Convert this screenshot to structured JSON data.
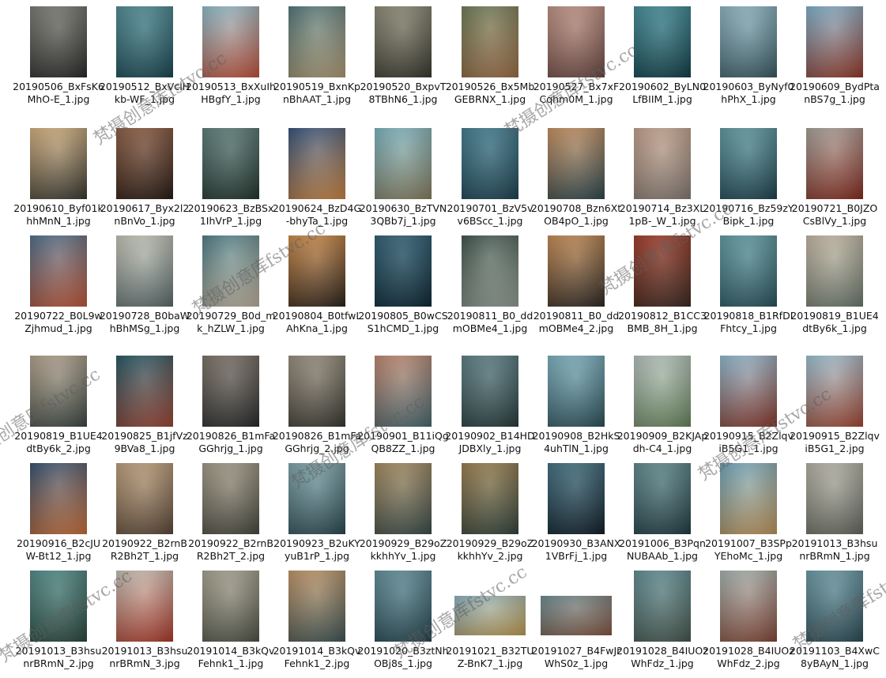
{
  "files": [
    {
      "name": "20190506_BxFsK6MhO-E_1.jpg",
      "c1": "#7a7a72",
      "c2": "#2b2d2a"
    },
    {
      "name": "20190512_BxVclHkb-WF_1.jpg",
      "c1": "#4d8a94",
      "c2": "#1c4a55"
    },
    {
      "name": "20190513_BxXuIhHBgfY_1.jpg",
      "c1": "#8cc0cf",
      "c2": "#c8553c"
    },
    {
      "name": "20190519_BxnKpnBhAAT_1.jpg",
      "c1": "#4e7578",
      "c2": "#b5a079"
    },
    {
      "name": "20190520_BxpvT8TBhN6_1.jpg",
      "c1": "#8d8a74",
      "c2": "#3b3a30"
    },
    {
      "name": "20190526_Bx5MbGEBRNX_1.jpg",
      "c1": "#6c7a56",
      "c2": "#a3724a"
    },
    {
      "name": "20190527_Bx7xFCqhm0M_1.jpg",
      "c1": "#c19383",
      "c2": "#6d4a44"
    },
    {
      "name": "20190602_ByLN0LfBIIM_1.jpg",
      "c1": "#3f8c98",
      "c2": "#14414b"
    },
    {
      "name": "20190603_ByNyf0hPhX_1.jpg",
      "c1": "#8fb7c4",
      "c2": "#3c5d66"
    },
    {
      "name": "20190609_BydPtanBS7g_1.jpg",
      "c1": "#7cb3cf",
      "c2": "#9b3c2a"
    },
    {
      "name": "20190610_Byf01khhMnN_1.jpg",
      "c1": "#d8b37e",
      "c2": "#3a3a34"
    },
    {
      "name": "20190617_Byx2l2nBnVo_1.jpg",
      "c1": "#8d5b3f",
      "c2": "#2a1c16"
    },
    {
      "name": "20190623_BzBSx1IhVrP_1.jpg",
      "c1": "#5b7d79",
      "c2": "#24362f"
    },
    {
      "name": "20190624_BzD4G-bhyTa_1.jpg",
      "c1": "#2d4f7a",
      "c2": "#d38a46"
    },
    {
      "name": "20190630_BzTVN3QBb7j_1.jpg",
      "c1": "#7bb5c3",
      "c2": "#8b8262"
    },
    {
      "name": "20190701_BzV5vv6BScc_1.jpg",
      "c1": "#3f7b8f",
      "c2": "#1f4553"
    },
    {
      "name": "20190708_Bzn6XtOB4pO_1.jpg",
      "c1": "#c9905d",
      "c2": "#2f4a52"
    },
    {
      "name": "20190714_Bz3XL1pB-_W_1.jpg",
      "c1": "#c5a28b",
      "c2": "#8a7f77"
    },
    {
      "name": "20190716_Bz59zYBipk_1.jpg",
      "c1": "#5f9aa4",
      "c2": "#1f4550"
    },
    {
      "name": "20190721_B0JZOCsBlVy_1.jpg",
      "c1": "#a7a39a",
      "c2": "#8a2d20"
    },
    {
      "name": "20190722_B0L9wZjhmud_1.jpg",
      "c1": "#486d8a",
      "c2": "#c75b3a"
    },
    {
      "name": "20190728_B0baWhBhMSg_1.jpg",
      "c1": "#c7c6b8",
      "c2": "#5d6f70"
    },
    {
      "name": "20190729_B0d_mk_hZLW_1.jpg",
      "c1": "#4a7c86",
      "c2": "#c6b8a2"
    },
    {
      "name": "20190804_B0tfwLAhKna_1.jpg",
      "c1": "#d18b45",
      "c2": "#2e241c"
    },
    {
      "name": "20190805_B0wCSS1hCMD_1.jpg",
      "c1": "#2b5d74",
      "c2": "#0f2a36"
    },
    {
      "name": "20190811_B0_ddmOBMe4_1.jpg",
      "c1": "#3a4f45",
      "c2": "#97a39a"
    },
    {
      "name": "20190811_B0_ddmOBMe4_2.jpg",
      "c1": "#c88b4f",
      "c2": "#2f2a26"
    },
    {
      "name": "20190812_B1CC3BMB_8H_1.jpg",
      "c1": "#a33724",
      "c2": "#3d2b22"
    },
    {
      "name": "20190818_B1RfDIFhtcy_1.jpg",
      "c1": "#5f9ba2",
      "c2": "#2c5660"
    },
    {
      "name": "20190819_B1UE4dtBy6k_1.jpg",
      "c1": "#c7b9a5",
      "c2": "#6f7d70"
    },
    {
      "name": "20190819_B1UE4dtBy6k_2.jpg",
      "c1": "#b6a48e",
      "c2": "#3e4a44"
    },
    {
      "name": "20190825_B1jfVz9BVa8_1.jpg",
      "c1": "#1e5563",
      "c2": "#a24a38"
    },
    {
      "name": "20190826_B1mFaGGhrjg_1.jpg",
      "c1": "#7c7266",
      "c2": "#2a2c2d"
    },
    {
      "name": "20190826_B1mFaGGhrjg_2.jpg",
      "c1": "#9a8f7c",
      "c2": "#3b3a33"
    },
    {
      "name": "20190901_B11iQgQB8ZZ_1.jpg",
      "c1": "#c4876d",
      "c2": "#4b6e75"
    },
    {
      "name": "20190902_B14HDJDBXly_1.jpg",
      "c1": "#5a7f86",
      "c2": "#2a3e3e"
    },
    {
      "name": "20190908_B2HkS4uhTlN_1.jpg",
      "c1": "#7db3c2",
      "c2": "#2f535b"
    },
    {
      "name": "20190909_B2KJApdh-C4_1.jpg",
      "c1": "#b8c3c0",
      "c2": "#6b8a60"
    },
    {
      "name": "20190915_B2ZlqviB5G1_1.jpg",
      "c1": "#8fbcd2",
      "c2": "#8e3a2c"
    },
    {
      "name": "20190915_B2ZlqviB5G1_2.jpg",
      "c1": "#9cc5d6",
      "c2": "#a94a34"
    },
    {
      "name": "20190916_B2cJUW-Bt12_1.jpg",
      "c1": "#2f4e6f",
      "c2": "#d0743c"
    },
    {
      "name": "20190922_B2rnBR2Bh2T_1.jpg",
      "c1": "#c0a07a",
      "c2": "#5e4a3a"
    },
    {
      "name": "20190922_B2rnBR2Bh2T_2.jpg",
      "c1": "#a39b86",
      "c2": "#4a4a40"
    },
    {
      "name": "20190923_B2uKYyuB1rP_1.jpg",
      "c1": "#7ea6ad",
      "c2": "#2c4b52"
    },
    {
      "name": "20190929_B29oZkkhhYv_1.jpg",
      "c1": "#a78a5c",
      "c2": "#3c4f4d"
    },
    {
      "name": "20190929_B29oZkkhhYv_2.jpg",
      "c1": "#9c7e4b",
      "c2": "#34473f"
    },
    {
      "name": "20190930_B3ANX1VBrFj_1.jpg",
      "c1": "#3e6f80",
      "c2": "#12202a"
    },
    {
      "name": "20191006_B3PqnNUBAAb_1.jpg",
      "c1": "#5f8a8e",
      "c2": "#223e44"
    },
    {
      "name": "20191007_B3SPpYEhoMc_1.jpg",
      "c1": "#6ea7c0",
      "c2": "#c79b5e"
    },
    {
      "name": "20191013_B3hsunrBRmN_1.jpg",
      "c1": "#b7b4a6",
      "c2": "#686c62"
    },
    {
      "name": "20191013_B3hsunrBRmN_2.jpg",
      "c1": "#4f8a88",
      "c2": "#2c4a3e"
    },
    {
      "name": "20191013_B3hsunrBRmN_3.jpg",
      "c1": "#c7c4b8",
      "c2": "#b23b2b"
    },
    {
      "name": "20191014_B3kQvFehnk1_1.jpg",
      "c1": "#a9a491",
      "c2": "#525548"
    },
    {
      "name": "20191014_B3kQvFehnk1_2.jpg",
      "c1": "#c49565",
      "c2": "#415858"
    },
    {
      "name": "20191020_B3ztNhOBj8s_1.jpg",
      "c1": "#5f8f9a",
      "c2": "#274751"
    },
    {
      "name": "20191021_B32TUZ-BnK7_1.jpg",
      "c1": "#8eb4c6",
      "c2": "#c6a154"
    },
    {
      "name": "20191027_B4FwJrWhS0z_1.jpg",
      "c1": "#6d8d93",
      "c2": "#8a5a44"
    },
    {
      "name": "20191028_B4IUOzWhFdz_1.jpg",
      "c1": "#5f8e95",
      "c2": "#4a5a50"
    },
    {
      "name": "20191028_B4IUOzWhFdz_2.jpg",
      "c1": "#a7b5b0",
      "c2": "#8a4a3a"
    },
    {
      "name": "20191103_B4XwC8yBAyN_1.jpg",
      "c1": "#6a9aa6",
      "c2": "#2f4e58"
    }
  ],
  "watermark": "梵摄创意库fstvc.cc"
}
